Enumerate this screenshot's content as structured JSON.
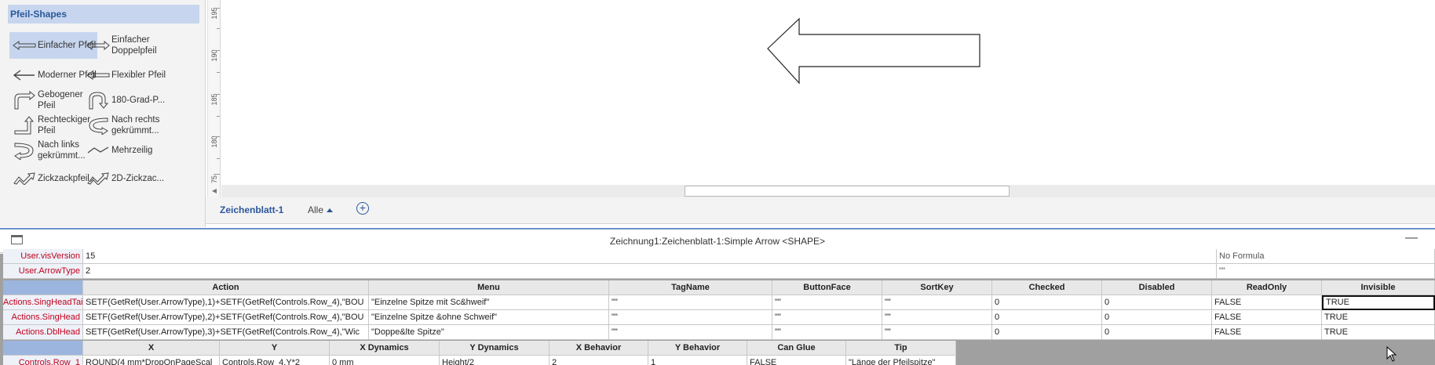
{
  "stencil": {
    "title": "Pfeil-Shapes",
    "items": [
      {
        "label": "Einfacher Pfeil",
        "icon": "simple-arrow-icon",
        "selected": true
      },
      {
        "label": "Einfacher Doppelpfeil",
        "icon": "double-arrow-icon"
      },
      {
        "label": "Moderner Pfeil",
        "icon": "modern-arrow-icon"
      },
      {
        "label": "Flexibler Pfeil",
        "icon": "flexible-arrow-icon"
      },
      {
        "label": "Gebogener Pfeil",
        "icon": "bent-arrow-icon"
      },
      {
        "label": "180-Grad-P...",
        "icon": "u-turn-arrow-icon"
      },
      {
        "label": "Rechteckiger Pfeil",
        "icon": "rectangular-arrow-icon"
      },
      {
        "label": "Nach rechts gekrümmt...",
        "icon": "curved-right-arrow-icon"
      },
      {
        "label": "Nach links gekrümmt...",
        "icon": "curved-left-arrow-icon"
      },
      {
        "label": "Mehrzeilig",
        "icon": "multiline-arrow-icon"
      },
      {
        "label": "Zickzackpfeil",
        "icon": "zigzag-arrow-icon"
      },
      {
        "label": "2D-Zickzac...",
        "icon": "zigzag-2d-arrow-icon"
      }
    ]
  },
  "ruler": {
    "labels": [
      "195",
      "190",
      "185",
      "180",
      "75"
    ]
  },
  "tabs": {
    "page": "Zeichenblatt-1",
    "all": "Alle",
    "add": "+"
  },
  "sheet": {
    "title": "Zeichnung1:Zeichenblatt-1:Simple Arrow <SHAPE>",
    "minimize": "—",
    "user_rows": [
      {
        "name": "User.visVersion",
        "value": "15",
        "prompt": "No Formula"
      },
      {
        "name": "User.ArrowType",
        "value": "2",
        "prompt": "\"\""
      }
    ],
    "actions": {
      "headers": [
        "Action",
        "Menu",
        "TagName",
        "ButtonFace",
        "SortKey",
        "Checked",
        "Disabled",
        "ReadOnly",
        "Invisible"
      ],
      "rows": [
        {
          "name": "Actions.SingHeadTail",
          "cells": [
            "SETF(GetRef(User.ArrowType),1)+SETF(GetRef(Controls.Row_4),\"BOU",
            "\"Einzelne Spitze mit Sc&hweif\"",
            "\"\"",
            "\"\"",
            "\"\"",
            "0",
            "0",
            "FALSE",
            "TRUE"
          ]
        },
        {
          "name": "Actions.SingHead",
          "cells": [
            "SETF(GetRef(User.ArrowType),2)+SETF(GetRef(Controls.Row_4),\"BOU",
            "\"Einzelne Spitze &ohne Schweif\"",
            "\"\"",
            "\"\"",
            "\"\"",
            "0",
            "0",
            "FALSE",
            "TRUE"
          ]
        },
        {
          "name": "Actions.DblHead",
          "cells": [
            "SETF(GetRef(User.ArrowType),3)+SETF(GetRef(Controls.Row_4),\"Wic",
            "\"Doppe&lte Spitze\"",
            "\"\"",
            "\"\"",
            "\"\"",
            "0",
            "0",
            "FALSE",
            "TRUE"
          ]
        }
      ]
    },
    "controls": {
      "headers": [
        "X",
        "Y",
        "X Dynamics",
        "Y Dynamics",
        "X Behavior",
        "Y Behavior",
        "Can Glue",
        "Tip"
      ],
      "rows": [
        {
          "name": "Controls.Row_1",
          "cells": [
            "ROUND(4 mm*DropOnPageScal",
            "Controls.Row_4.Y*2",
            "0 mm",
            "Height/2",
            "2",
            "1",
            "FALSE",
            "\"Länge der Pfeilspitze\""
          ]
        }
      ]
    }
  },
  "colors": {
    "accent": "#2b579a",
    "selection": "#c7d6ee",
    "rowname": "#c0001e"
  }
}
